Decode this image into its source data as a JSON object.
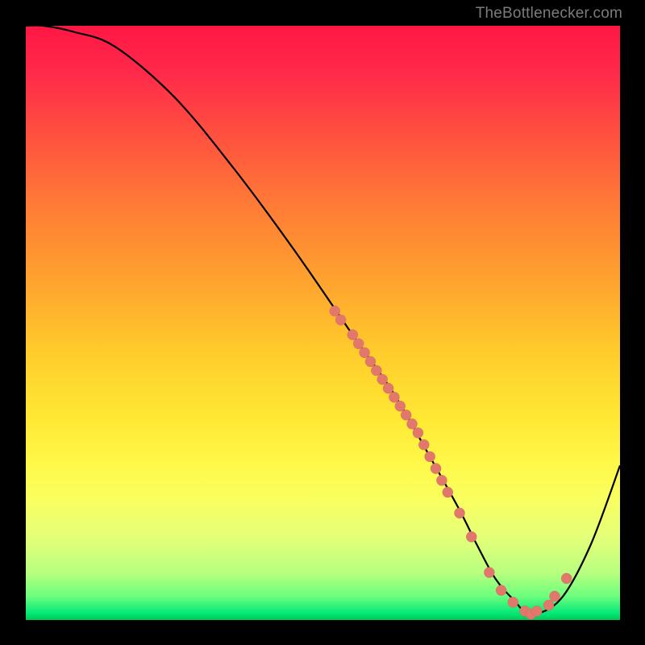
{
  "attribution": {
    "text": "TheBottlenecker.com"
  },
  "colors": {
    "background": "#000000",
    "curve": "#000000",
    "point_fill": "#e2776b",
    "attribution_text": "#7b7b7b",
    "gradient_top": "#ff1744",
    "gradient_mid": "#ffe833",
    "gradient_bottom": "#00c853"
  },
  "chart_data": {
    "type": "line",
    "title": "",
    "xlabel": "",
    "ylabel": "",
    "x_range": [
      0,
      100
    ],
    "y_range": [
      0,
      100
    ],
    "grid": false,
    "legend": false,
    "note": "Axes are unlabeled in the image; x and y are normalized to 0–100 of the plot area, with y measured from the bottom.",
    "curve": {
      "name": "bottleneck-curve",
      "x": [
        0,
        3,
        8,
        15,
        25,
        35,
        45,
        55,
        62,
        68,
        73,
        76,
        79,
        82,
        85,
        90,
        95,
        100
      ],
      "y": [
        100,
        100,
        99,
        96.5,
        88,
        76,
        62.5,
        48,
        38,
        27.5,
        18.5,
        12.5,
        7,
        3.5,
        1,
        3.5,
        12.5,
        26
      ]
    },
    "series": [
      {
        "name": "highlighted-points",
        "type": "scatter",
        "x": [
          52,
          53,
          55,
          56,
          57,
          58,
          59,
          60,
          61,
          62,
          63,
          64,
          65,
          66,
          67,
          68,
          69,
          70,
          71,
          73,
          75,
          78,
          80,
          82,
          84,
          85,
          86,
          88,
          89,
          91
        ],
        "y": [
          52,
          50.5,
          48,
          46.5,
          45,
          43.5,
          42,
          40.5,
          39,
          37.5,
          36,
          34.5,
          33,
          31.5,
          29.5,
          27.5,
          25.5,
          23.5,
          21.5,
          18,
          14,
          8,
          5,
          3,
          1.5,
          1,
          1.5,
          2.5,
          4,
          7
        ]
      }
    ]
  }
}
